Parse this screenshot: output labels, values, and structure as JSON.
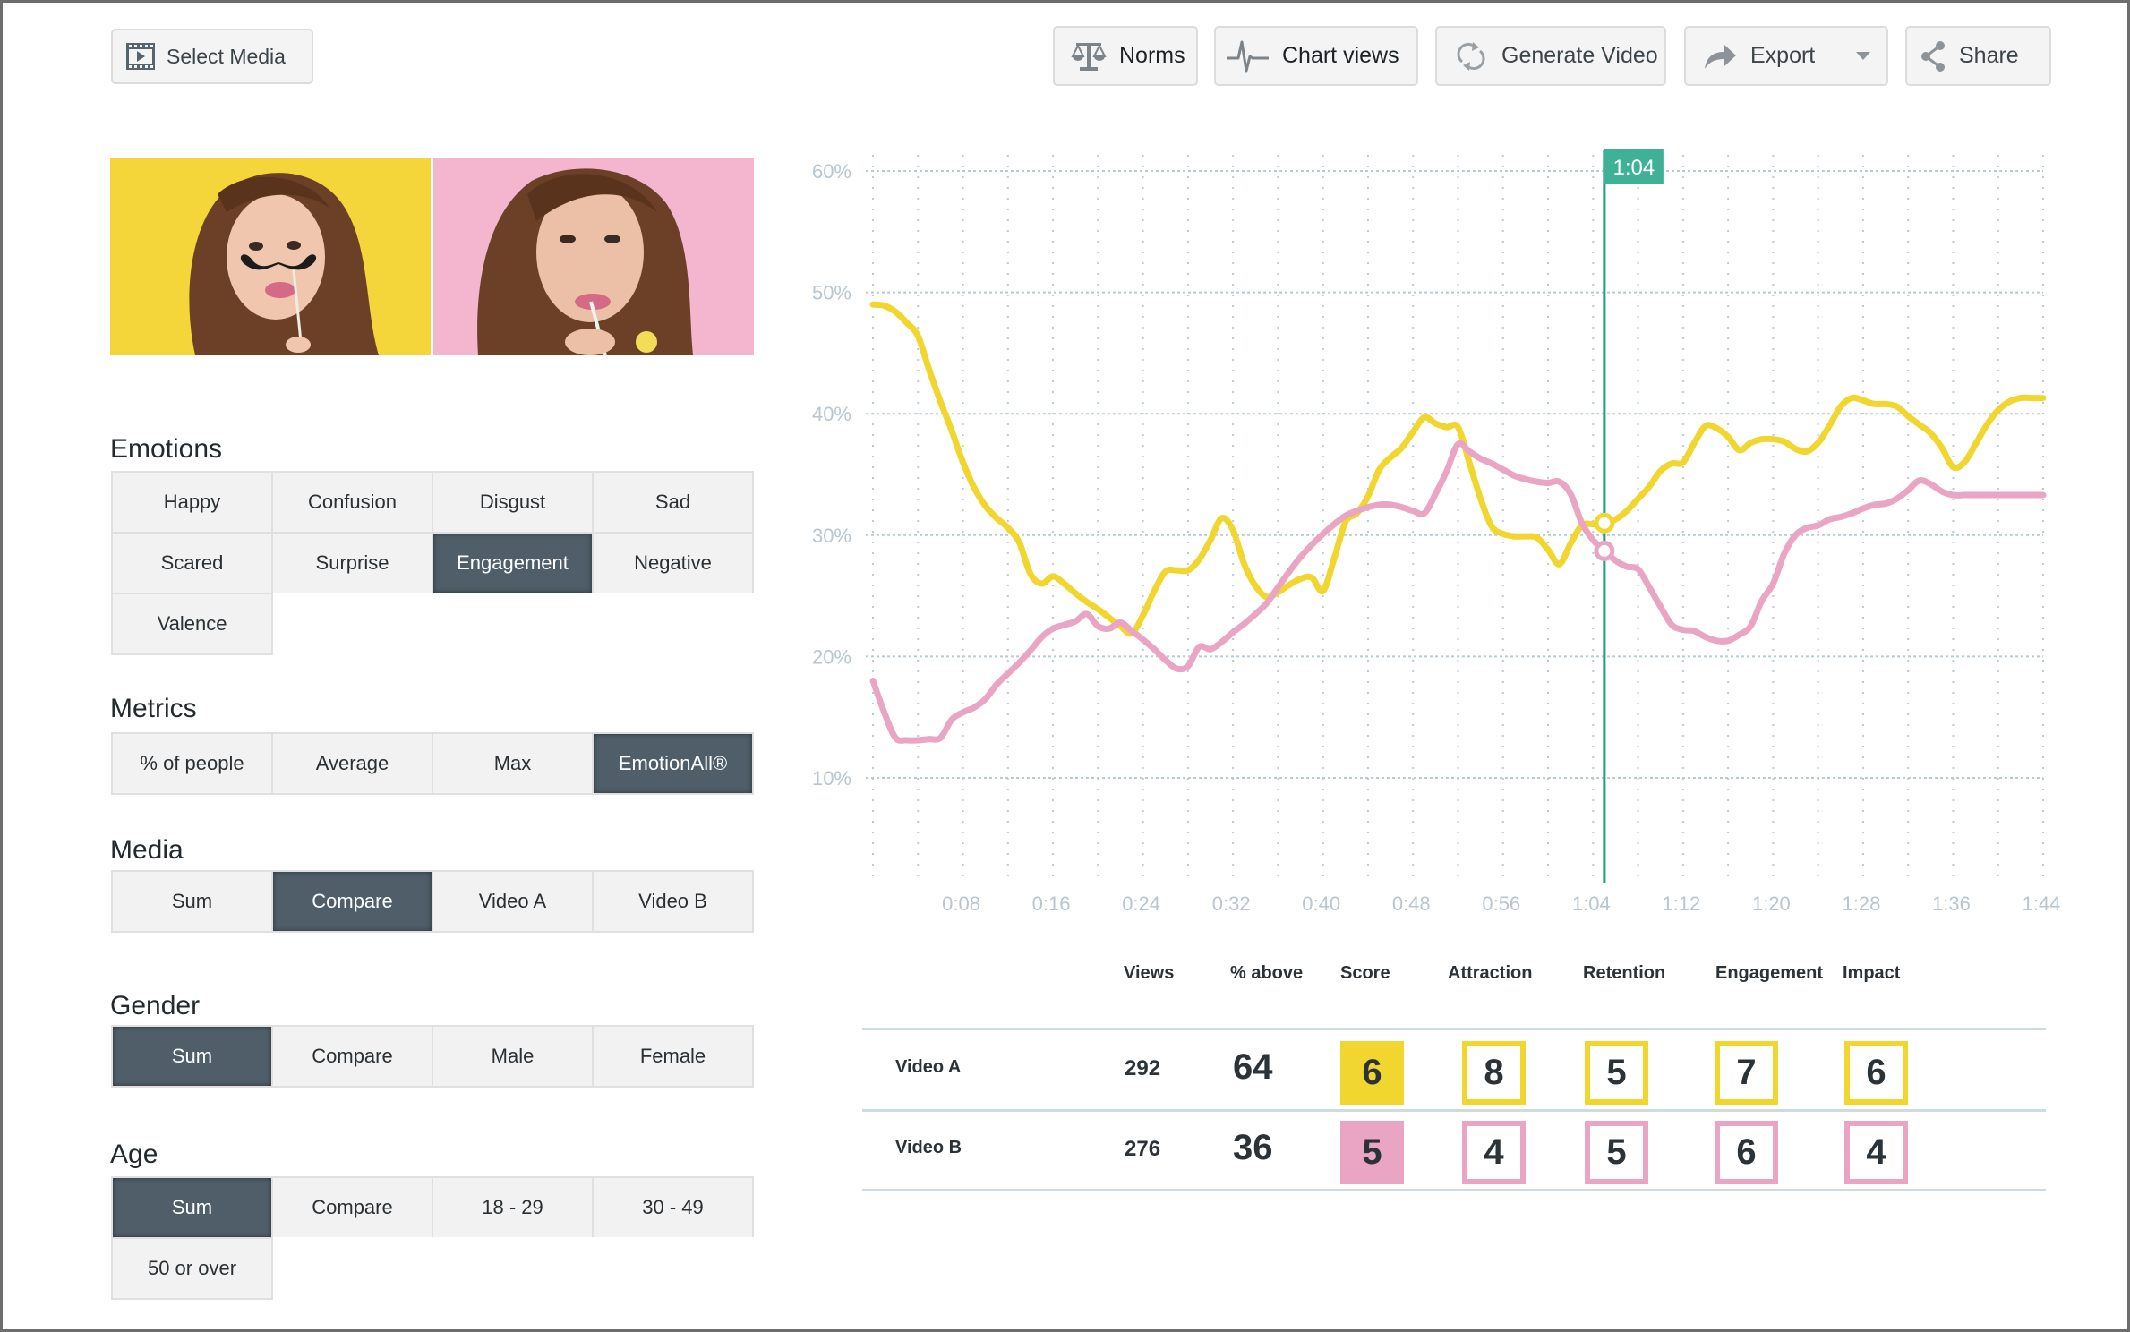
{
  "toolbar": {
    "select_media": {
      "label": "Select Media",
      "icon": "film-icon"
    },
    "buttons": [
      {
        "label": "Norms",
        "icon": "scale-icon"
      },
      {
        "label": "Chart views",
        "icon": "pulse-icon"
      },
      {
        "label": "Generate Video",
        "icon": "refresh-icon"
      },
      {
        "label": "Export",
        "icon": "share-arrow-icon",
        "has_dropdown": true
      },
      {
        "label": "Share",
        "icon": "share-icon"
      }
    ]
  },
  "media_thumbnails": [
    {
      "name": "Video A",
      "background": "#f5d63a",
      "description": "woman with mustache prop on yellow background"
    },
    {
      "name": "Video B",
      "background": "#f4b6cf",
      "description": "woman drinking through straw on pink background"
    }
  ],
  "filters": {
    "emotions": {
      "label": "Emotions",
      "options": [
        "Happy",
        "Confusion",
        "Disgust",
        "Sad",
        "Scared",
        "Surprise",
        "Engagement",
        "Negative",
        "Valence"
      ],
      "selected": "Engagement"
    },
    "metrics": {
      "label": "Metrics",
      "options": [
        "% of people",
        "Average",
        "Max",
        "EmotionAll®"
      ],
      "selected": "EmotionAll®"
    },
    "media": {
      "label": "Media",
      "options": [
        "Sum",
        "Compare",
        "Video A",
        "Video B"
      ],
      "selected": "Compare"
    },
    "gender": {
      "label": "Gender",
      "options": [
        "Sum",
        "Compare",
        "Male",
        "Female"
      ],
      "selected": "Sum"
    },
    "age": {
      "label": "Age",
      "options": [
        "Sum",
        "Compare",
        "18 - 29",
        "30 - 49",
        "50 or over"
      ],
      "selected": "Sum"
    }
  },
  "colors": {
    "video_a": "#f2d630",
    "video_b": "#eaa5c4",
    "marker": "#1f9e84",
    "marker_label_bg": "#3fb197",
    "active_button": "#4f5e68",
    "grid": "#b9cbd4"
  },
  "chart_data": {
    "type": "line",
    "title": "",
    "xlabel": "",
    "ylabel": "",
    "x_unit": "seconds",
    "xlim": [
      0,
      104
    ],
    "ylim": [
      0,
      60
    ],
    "y_ticks": [
      10,
      20,
      30,
      40,
      50,
      60
    ],
    "y_tick_labels": [
      "10%",
      "20%",
      "30%",
      "40%",
      "50%",
      "60%"
    ],
    "x_ticks": [
      8,
      16,
      24,
      32,
      40,
      48,
      56,
      64,
      72,
      80,
      88,
      96,
      104
    ],
    "x_tick_labels": [
      "0:08",
      "0:16",
      "0:24",
      "0:32",
      "0:40",
      "0:48",
      "0:56",
      "1:04",
      "1:12",
      "1:20",
      "1:28",
      "1:36",
      "1:44"
    ],
    "grid": true,
    "cursor": {
      "label": "1:04",
      "x": 65
    },
    "x": [
      0,
      1,
      2,
      3,
      4,
      5,
      6,
      7,
      8,
      9,
      10,
      11,
      12,
      13,
      14,
      15,
      16,
      17,
      18,
      19,
      20,
      21,
      22,
      23,
      24,
      25,
      26,
      27,
      28,
      29,
      30,
      31,
      32,
      33,
      34,
      35,
      36,
      37,
      38,
      39,
      40,
      41,
      42,
      43,
      44,
      45,
      46,
      47,
      48,
      49,
      50,
      51,
      52,
      53,
      54,
      55,
      56,
      57,
      58,
      59,
      60,
      61,
      62,
      63,
      64,
      65,
      66,
      67,
      68,
      69,
      70,
      71,
      72,
      73,
      74,
      75,
      76,
      77,
      78,
      79,
      80,
      81,
      82,
      83,
      84,
      85,
      86,
      87,
      88,
      89,
      90,
      91,
      92,
      93,
      94,
      95,
      96,
      97,
      98,
      99,
      100,
      101,
      102,
      103,
      104
    ],
    "series": [
      {
        "name": "Video A",
        "color": "#f2d630",
        "values": [
          49.0,
          48.9,
          48.4,
          47.5,
          46.4,
          43.6,
          41.0,
          38.6,
          36.0,
          33.9,
          32.4,
          31.4,
          30.6,
          29.4,
          26.8,
          26.0,
          26.6,
          26.0,
          25.2,
          24.5,
          23.9,
          23.2,
          22.5,
          21.9,
          23.4,
          25.4,
          27.0,
          27.1,
          27.1,
          28.0,
          29.6,
          31.4,
          30.4,
          27.6,
          25.8,
          24.9,
          25.3,
          25.9,
          26.4,
          26.5,
          25.4,
          28.1,
          31.1,
          31.8,
          33.2,
          35.4,
          36.4,
          37.2,
          38.5,
          39.7,
          39.2,
          38.9,
          38.9,
          36.0,
          33.0,
          30.7,
          30.1,
          29.9,
          29.9,
          29.8,
          28.8,
          27.6,
          29.3,
          30.8,
          30.9,
          31.0,
          31.3,
          32.0,
          33.0,
          34.0,
          35.3,
          35.9,
          36.0,
          37.6,
          39.0,
          38.8,
          38.1,
          37.0,
          37.6,
          37.9,
          37.9,
          37.7,
          37.1,
          36.9,
          37.6,
          39.0,
          40.6,
          41.3,
          41.1,
          40.8,
          40.8,
          40.6,
          39.8,
          39.1,
          38.4,
          37.2,
          35.6,
          36.0,
          37.5,
          39.1,
          40.3,
          41.0,
          41.3,
          41.3,
          41.3
        ]
      },
      {
        "name": "Video B",
        "color": "#eaa5c4",
        "values": [
          18.0,
          15.4,
          13.3,
          13.1,
          13.1,
          13.2,
          13.3,
          14.8,
          15.4,
          15.8,
          16.5,
          17.7,
          18.6,
          19.5,
          20.5,
          21.6,
          22.3,
          22.6,
          22.9,
          23.5,
          22.5,
          22.3,
          22.8,
          22.1,
          21.4,
          20.6,
          19.7,
          19.0,
          19.2,
          20.8,
          20.6,
          21.2,
          22.0,
          22.7,
          23.5,
          24.4,
          25.7,
          27.0,
          28.2,
          29.2,
          30.1,
          30.9,
          31.6,
          32.0,
          32.3,
          32.5,
          32.5,
          32.3,
          32.0,
          31.8,
          33.4,
          35.3,
          37.5,
          36.9,
          36.3,
          35.9,
          35.4,
          34.9,
          34.6,
          34.4,
          34.3,
          34.4,
          33.4,
          31.0,
          29.6,
          28.7,
          27.9,
          27.4,
          27.2,
          25.7,
          24.1,
          22.6,
          22.2,
          22.1,
          21.6,
          21.3,
          21.3,
          21.8,
          22.5,
          24.6,
          26.0,
          28.5,
          30.0,
          30.6,
          30.8,
          31.3,
          31.5,
          31.8,
          32.2,
          32.5,
          32.6,
          33.0,
          33.7,
          34.5,
          34.2,
          33.6,
          33.3,
          33.3,
          33.3,
          33.3,
          33.3,
          33.3,
          33.3,
          33.3,
          33.3
        ]
      }
    ]
  },
  "score_table": {
    "columns": [
      "Views",
      "% above",
      "Score",
      "Attraction",
      "Retention",
      "Engagement",
      "Impact"
    ],
    "rows": [
      {
        "label": "Video A",
        "views": "292",
        "pct_above": "64",
        "score": "6",
        "attraction": "8",
        "retention": "5",
        "engagement": "7",
        "impact": "6"
      },
      {
        "label": "Video B",
        "views": "276",
        "pct_above": "36",
        "score": "5",
        "attraction": "4",
        "retention": "5",
        "engagement": "6",
        "impact": "4"
      }
    ]
  }
}
